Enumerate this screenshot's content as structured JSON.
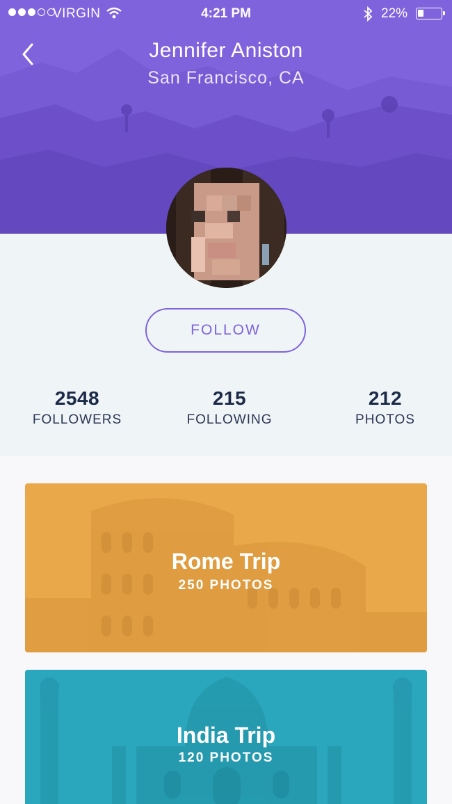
{
  "status_bar": {
    "carrier": "VIRGIN",
    "time": "4:21 PM",
    "battery": "22%"
  },
  "profile": {
    "name": "Jennifer Aniston",
    "location": "San Francisco, CA",
    "follow_label": "FOLLOW",
    "stats": [
      {
        "value": "2548",
        "label": "FOLLOWERS"
      },
      {
        "value": "215",
        "label": "FOLLOWING"
      },
      {
        "value": "212",
        "label": "PHOTOS"
      }
    ]
  },
  "trips": [
    {
      "title": "Rome Trip",
      "count": "250 PHOTOS",
      "color": "#e9a849"
    },
    {
      "title": "India Trip",
      "count": "120 PHOTOS",
      "color": "#2ba7bd"
    }
  ],
  "colors": {
    "accent": "#7f63dc",
    "panel": "#eff4f6"
  }
}
